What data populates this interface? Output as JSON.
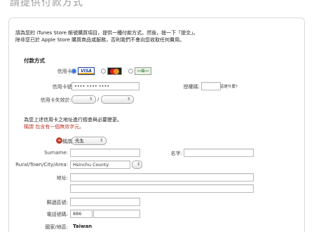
{
  "page": {
    "heading": "請提供付款方式"
  },
  "intro": {
    "line1": "請為您的 iTunes Store 帳號購買項目，提供一種付款方式。然後，按一下「提交」。",
    "line2": "除非您已於 Apple Store 購買商品或服務，否則我們不會向您收取任何費用。"
  },
  "payment": {
    "section_title": "付款方式",
    "card_type_label": "信用卡:",
    "card_types": [
      {
        "name": "VISA",
        "selected": true
      },
      {
        "name": "MasterCard",
        "selected": false
      },
      {
        "name": "JCB",
        "selected": false
      }
    ],
    "card_number_label": "信用卡號:",
    "card_number_value": "•••• •••• ••••",
    "auth_code_label": "授權碼:",
    "auth_code_help": "這是什麼?",
    "expiry_label": "信用卡失效於:",
    "expiry_separator": "/"
  },
  "billing": {
    "note_line1": "為您上述信用卡之地址進行檢查與必要變更。",
    "note_line2": "稱謂 包含有一個無效字元。",
    "title_label": "稱謂:",
    "title_value": "先生",
    "surname_label": "Surname:",
    "given_name_label": "名字:",
    "region_label": "Rural/Town/City/Area:",
    "region_value": "Hsinchu County",
    "address_label": "地址:",
    "postal_label": "郵遞區號:",
    "phone_label": "電話號碼:",
    "phone_prefix": "886",
    "country_label": "國家/地區:",
    "country_value": "Taiwan"
  },
  "colors": {
    "error": "#c0392b",
    "accent": "#1a5fd6"
  }
}
